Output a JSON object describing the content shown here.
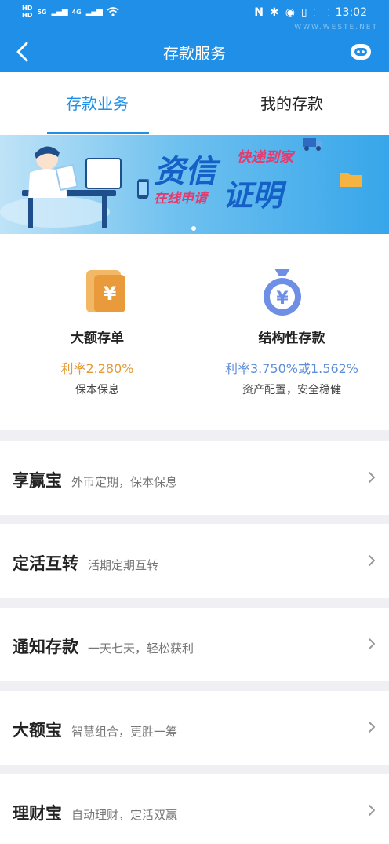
{
  "status_bar": {
    "hd1": "HD",
    "hd2": "HD",
    "net1": "5G",
    "net2": "4G",
    "icons": [
      "nfc-icon",
      "bluetooth-icon",
      "location-icon",
      "vibrate-icon",
      "battery-icon"
    ],
    "time": "13:02",
    "watermark": "WWW.WESTE.NET"
  },
  "header": {
    "title": "存款服务"
  },
  "tabs": [
    {
      "label": "存款业务",
      "active": true
    },
    {
      "label": "我的存款",
      "active": false
    }
  ],
  "banner": {
    "main_left": "资信",
    "tag_top": "快递到家",
    "tag_bottom": "在线申请",
    "main_right": "证明"
  },
  "products": [
    {
      "name": "大额存单",
      "rate": "利率2.280%",
      "desc": "保本保息",
      "rate_color": "#e39a35",
      "icon": "yen-card-icon"
    },
    {
      "name": "结构性存款",
      "rate": "利率3.750%或1.562%",
      "desc": "资产配置，安全稳健",
      "rate_color": "#5d8ed8",
      "icon": "money-bag-icon"
    }
  ],
  "list": [
    {
      "title": "享赢宝",
      "subtitle": "外币定期，保本保息"
    },
    {
      "title": "定活互转",
      "subtitle": "活期定期互转"
    },
    {
      "title": "通知存款",
      "subtitle": "一天七天，轻松获利"
    },
    {
      "title": "大额宝",
      "subtitle": "智慧组合，更胜一筹"
    },
    {
      "title": "理财宝",
      "subtitle": "自动理财，定活双赢"
    }
  ],
  "colors": {
    "primary": "#1f8fe7",
    "accent_orange": "#e39a35",
    "accent_blue": "#5d8ed8"
  }
}
